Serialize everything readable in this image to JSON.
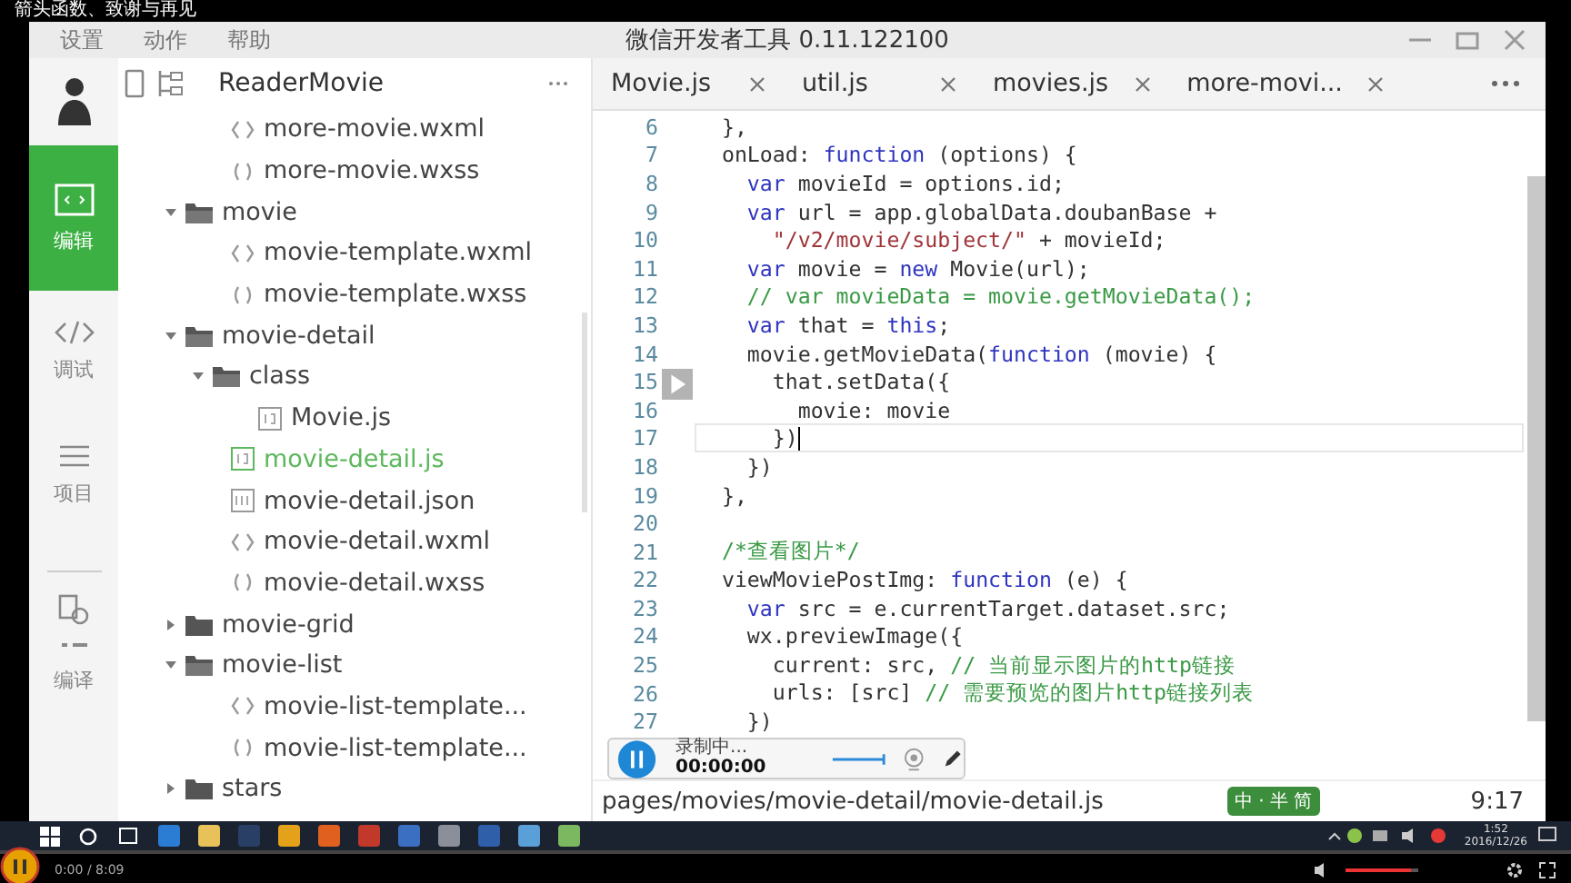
{
  "video_title": "箭头函数、致谢与再见",
  "menu": [
    "设置",
    "动作",
    "帮助"
  ],
  "window": {
    "title": "微信开发者工具 0.11.122100"
  },
  "nav": [
    {
      "kind": "edit",
      "label": "编辑",
      "selected": true
    },
    {
      "kind": "debug",
      "label": "调试",
      "selected": false
    },
    {
      "kind": "project",
      "label": "项目",
      "selected": false
    },
    {
      "kind": "compile",
      "label": "编译",
      "selected": false
    }
  ],
  "project": {
    "name": "ReaderMovie"
  },
  "tree": [
    {
      "kind": "group",
      "children": [
        {
          "kind": "wxml",
          "label": "more-movie.wxml",
          "selected": false
        },
        {
          "kind": "wxss",
          "label": "more-movie.wxss",
          "selected": false
        }
      ]
    },
    {
      "kind": "folder",
      "label": "movie",
      "expanded": true,
      "children": [
        {
          "kind": "wxml",
          "label": "movie-template.wxml",
          "selected": false
        },
        {
          "kind": "wxss",
          "label": "movie-template.wxss",
          "selected": false
        }
      ]
    },
    {
      "kind": "folder",
      "label": "movie-detail",
      "expanded": true,
      "children": [
        {
          "kind": "folder",
          "label": "class",
          "expanded": true,
          "children": [
            {
              "kind": "js",
              "label": "Movie.js",
              "selected": false
            }
          ]
        },
        {
          "kind": "js",
          "label": "movie-detail.js",
          "selected": true
        },
        {
          "kind": "json",
          "label": "movie-detail.json",
          "selected": false
        },
        {
          "kind": "wxml",
          "label": "movie-detail.wxml",
          "selected": false
        },
        {
          "kind": "wxss",
          "label": "movie-detail.wxss",
          "selected": false
        }
      ]
    },
    {
      "kind": "folder",
      "label": "movie-grid",
      "expanded": false
    },
    {
      "kind": "folder",
      "label": "movie-list",
      "expanded": true,
      "children": [
        {
          "kind": "wxml",
          "label": "movie-list-template...",
          "selected": false
        },
        {
          "kind": "wxss",
          "label": "movie-list-template...",
          "selected": false
        }
      ]
    },
    {
      "kind": "folder",
      "label": "stars",
      "expanded": false
    }
  ],
  "tabs": [
    {
      "label": "Movie.js",
      "selected": false
    },
    {
      "label": "util.js",
      "selected": false
    },
    {
      "label": "movies.js",
      "selected": false
    },
    {
      "label": "more-movi...",
      "selected": false
    }
  ],
  "code": [
    {
      "num": "6",
      "current": false,
      "tokens": [
        {
          "kind": "plain",
          "t": "  },"
        }
      ]
    },
    {
      "num": "7",
      "current": false,
      "tokens": [
        {
          "kind": "plain",
          "t": "  onLoad: "
        },
        {
          "kind": "keyword",
          "t": "function"
        },
        {
          "kind": "plain",
          "t": " (options) {"
        }
      ]
    },
    {
      "num": "8",
      "current": false,
      "tokens": [
        {
          "kind": "keyword",
          "t": "    var"
        },
        {
          "kind": "plain",
          "t": " movieId = options.id;"
        }
      ]
    },
    {
      "num": "9",
      "current": false,
      "tokens": [
        {
          "kind": "keyword",
          "t": "    var"
        },
        {
          "kind": "plain",
          "t": " url = app.globalData.doubanBase +"
        }
      ]
    },
    {
      "num": "10",
      "current": false,
      "tokens": [
        {
          "kind": "string",
          "t": "      \"/v2/movie/subject/\""
        },
        {
          "kind": "plain",
          "t": " + movieId;"
        }
      ]
    },
    {
      "num": "11",
      "current": false,
      "tokens": [
        {
          "kind": "keyword",
          "t": "    var"
        },
        {
          "kind": "plain",
          "t": " movie = "
        },
        {
          "kind": "keyword",
          "t": "new"
        },
        {
          "kind": "plain",
          "t": " Movie(url);"
        }
      ]
    },
    {
      "num": "12",
      "current": false,
      "tokens": [
        {
          "kind": "comment",
          "t": "    // var movieData = movie.getMovieData();"
        }
      ]
    },
    {
      "num": "13",
      "current": false,
      "tokens": [
        {
          "kind": "keyword",
          "t": "    var"
        },
        {
          "kind": "plain",
          "t": " that = "
        },
        {
          "kind": "keyword",
          "t": "this"
        },
        {
          "kind": "plain",
          "t": ";"
        }
      ]
    },
    {
      "num": "14",
      "current": false,
      "tokens": [
        {
          "kind": "plain",
          "t": "    movie.getMovieData("
        },
        {
          "kind": "keyword",
          "t": "function"
        },
        {
          "kind": "plain",
          "t": " (movie) {"
        }
      ]
    },
    {
      "num": "15",
      "current": false,
      "tokens": [
        {
          "kind": "plain",
          "t": "      that.setData({"
        }
      ]
    },
    {
      "num": "16",
      "current": false,
      "tokens": [
        {
          "kind": "plain",
          "t": "        movie: movie"
        }
      ]
    },
    {
      "num": "17",
      "current": true,
      "tokens": [
        {
          "kind": "plain",
          "t": "      })"
        }
      ]
    },
    {
      "num": "18",
      "current": false,
      "tokens": [
        {
          "kind": "plain",
          "t": "    })"
        }
      ]
    },
    {
      "num": "19",
      "current": false,
      "tokens": [
        {
          "kind": "plain",
          "t": "  },"
        }
      ]
    },
    {
      "num": "20",
      "current": false
    },
    {
      "num": "21",
      "current": false,
      "tokens": [
        {
          "kind": "comment",
          "t": "  /*查看图片*/"
        }
      ]
    },
    {
      "num": "22",
      "current": false,
      "tokens": [
        {
          "kind": "plain",
          "t": "  viewMoviePostImg: "
        },
        {
          "kind": "keyword",
          "t": "function"
        },
        {
          "kind": "plain",
          "t": " (e) {"
        }
      ]
    },
    {
      "num": "23",
      "current": false,
      "tokens": [
        {
          "kind": "keyword",
          "t": "    var"
        },
        {
          "kind": "plain",
          "t": " src = e.currentTarget.dataset.src;"
        }
      ]
    },
    {
      "num": "24",
      "current": false,
      "tokens": [
        {
          "kind": "plain",
          "t": "    wx.previewImage({"
        }
      ]
    },
    {
      "num": "25",
      "current": false,
      "tokens": [
        {
          "kind": "plain",
          "t": "      current: src, "
        },
        {
          "kind": "comment",
          "t": "// 当前显示图片的http链接"
        }
      ]
    },
    {
      "num": "26",
      "current": false,
      "tokens": [
        {
          "kind": "plain",
          "t": "      urls: [src] "
        },
        {
          "kind": "comment",
          "t": "// 需要预览的图片http链接列表"
        }
      ]
    },
    {
      "num": "27",
      "current": false,
      "tokens": [
        {
          "kind": "plain",
          "t": "    })"
        }
      ]
    }
  ],
  "status_bar": {
    "path": "pages/movies/movie-detail/movie-detail.js",
    "ime": "中 · 半 简",
    "position": "9:17"
  },
  "recorder": {
    "status": "录制中...",
    "time": "00:00:00"
  },
  "tray": {
    "time": "1:52",
    "date": "2016/12/26"
  },
  "player": {
    "time": "0:00 / 8:09",
    "progress": {
      "level": 0
    },
    "volume": {
      "level": 0.9
    }
  }
}
